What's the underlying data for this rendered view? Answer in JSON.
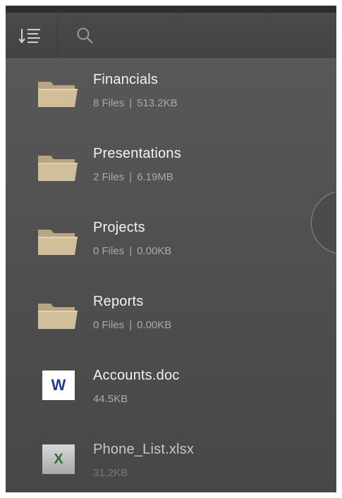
{
  "toolbar": {
    "sort_icon": "sort-list-icon",
    "search_icon": "search-icon"
  },
  "items": [
    {
      "type": "folder",
      "name": "Financials",
      "files": "8 Files",
      "size": "513.2KB"
    },
    {
      "type": "folder",
      "name": "Presentations",
      "files": "2 Files",
      "size": "6.19MB"
    },
    {
      "type": "folder",
      "name": "Projects",
      "files": "0 Files",
      "size": "0.00KB"
    },
    {
      "type": "folder",
      "name": "Reports",
      "files": "0 Files",
      "size": "0.00KB"
    },
    {
      "type": "word",
      "name": "Accounts.doc",
      "size": "44.5KB",
      "badge": "W"
    },
    {
      "type": "excel",
      "name": "Phone_List.xlsx",
      "size": "31.2KB",
      "badge": "X"
    }
  ],
  "separator": "|",
  "colors": {
    "background": "#545454",
    "folder": "#cdbb95",
    "word_badge": "#1d3d96",
    "excel_badge": "#2e6b3a",
    "text_primary": "#f2f2f2",
    "text_secondary": "#a9a9a9"
  }
}
